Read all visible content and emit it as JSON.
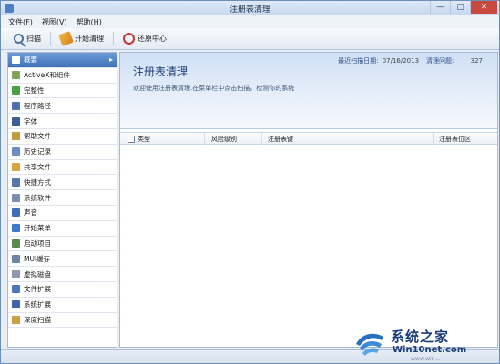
{
  "window": {
    "title": "注册表清理",
    "controls": {
      "minimize": "—",
      "maximize": "▢",
      "close": "✕"
    }
  },
  "menubar": {
    "items": [
      "文件(F)",
      "视图(V)",
      "帮助(H)"
    ]
  },
  "toolbar": {
    "scan_label": "扫描",
    "clean_label": "开始清理",
    "restore_label": "还原中心"
  },
  "sidebar": {
    "items": [
      {
        "label": "概要",
        "icon": "summary-icon",
        "color": "#4a7cc0"
      },
      {
        "label": "ActiveX和组件",
        "icon": "activex-icon",
        "color": "#7fa35a"
      },
      {
        "label": "完整性",
        "icon": "integrity-icon",
        "color": "#4aa044"
      },
      {
        "label": "程序路径",
        "icon": "program-path-icon",
        "color": "#4d6fb0"
      },
      {
        "label": "字体",
        "icon": "font-icon",
        "color": "#3b5d9a"
      },
      {
        "label": "帮助文件",
        "icon": "help-file-icon",
        "color": "#c29b3c"
      },
      {
        "label": "历史记录",
        "icon": "history-icon",
        "color": "#6b8fc4"
      },
      {
        "label": "共享文件",
        "icon": "shared-file-icon",
        "color": "#d8a43a"
      },
      {
        "label": "快捷方式",
        "icon": "shortcut-icon",
        "color": "#5577aa"
      },
      {
        "label": "系统软件",
        "icon": "system-software-icon",
        "color": "#7b8fb0"
      },
      {
        "label": "声音",
        "icon": "sound-icon",
        "color": "#3f6fb8"
      },
      {
        "label": "开始菜单",
        "icon": "start-menu-icon",
        "color": "#3a7bc8"
      },
      {
        "label": "启动项目",
        "icon": "startup-icon",
        "color": "#5a8c50"
      },
      {
        "label": "MUI缓存",
        "icon": "mui-cache-icon",
        "color": "#6f85a8"
      },
      {
        "label": "虚拟磁盘",
        "icon": "virtual-disk-icon",
        "color": "#8a98b0"
      },
      {
        "label": "文件扩展",
        "icon": "file-extension-icon",
        "color": "#4f78b8"
      },
      {
        "label": "系统扩展",
        "icon": "system-extension-icon",
        "color": "#3e64a8"
      },
      {
        "label": "深度扫描",
        "icon": "deep-scan-icon",
        "color": "#c9a048"
      }
    ]
  },
  "main": {
    "title": "注册表清理",
    "description": "欢迎使用注册表清理.在菜单栏中点击扫描，检测你的系统",
    "last_scan_label": "最近扫描日期:",
    "last_scan_value": "07/16/2013",
    "issues_label": "清理问题:",
    "issues_value": "327",
    "columns": {
      "type": "类型",
      "risk": "风险级别",
      "key": "注册表键",
      "location": "注册表位区"
    }
  },
  "watermark": {
    "cn": "系统之家",
    "en": "Win10net.com",
    "sub": "www.win..."
  },
  "colors": {
    "accent": "#3f72b8",
    "title_text": "#1a3c73",
    "close_button": "#c9493d"
  }
}
